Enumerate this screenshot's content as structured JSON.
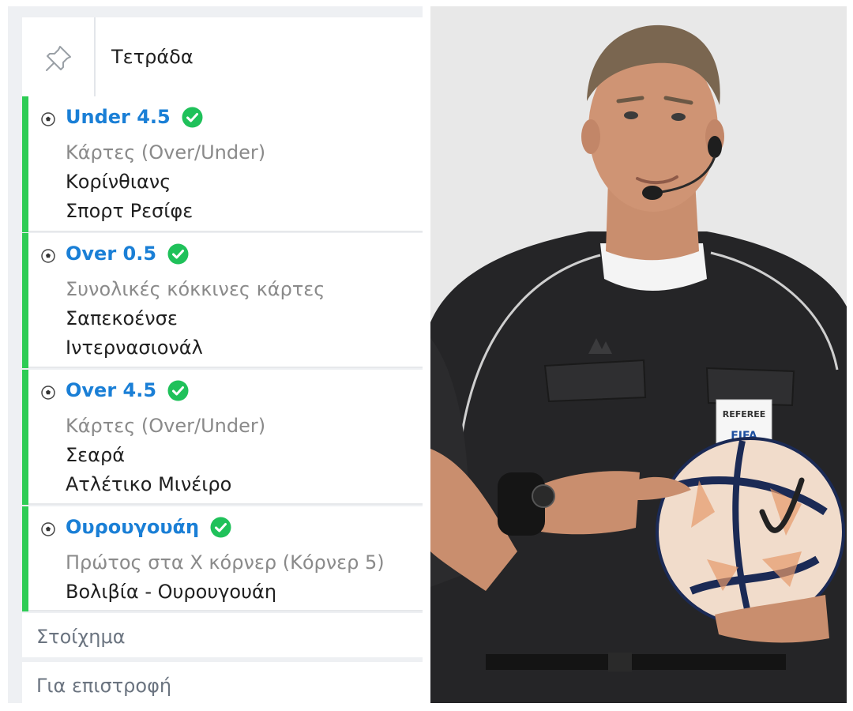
{
  "slip": {
    "title": "Τετράδα",
    "pin_icon": "pin-icon",
    "selections": [
      {
        "pick": "Under 4.5",
        "market": "Κάρτες (Over/Under)",
        "teams": [
          "Κορίνθιανς",
          "Σπορτ Ρεσίφε"
        ]
      },
      {
        "pick": "Over 0.5",
        "market": "Συνολικές κόκκινες κάρτες",
        "teams": [
          "Σαπεκοένσε",
          "Ιντερνασιονάλ"
        ]
      },
      {
        "pick": "Over 4.5",
        "market": "Κάρτες (Over/Under)",
        "teams": [
          "Σεαρά",
          "Ατλέτικο Μινέιρο"
        ]
      },
      {
        "pick": "Ουρουγουάη",
        "market": "Πρώτος στα Χ κόρνερ (Κόρνερ 5)",
        "teams": [
          "Βολιβία - Ουρουγουάη"
        ]
      }
    ],
    "stake_label": "Στοίχημα",
    "return_label": "Για επιστροφή"
  },
  "photo": {
    "badge_text": "REFEREE",
    "badge_sub": "FIFA"
  },
  "colors": {
    "accent_green": "#2ecc55",
    "pick_blue": "#1a7fd6",
    "check_green": "#1fc15a"
  }
}
